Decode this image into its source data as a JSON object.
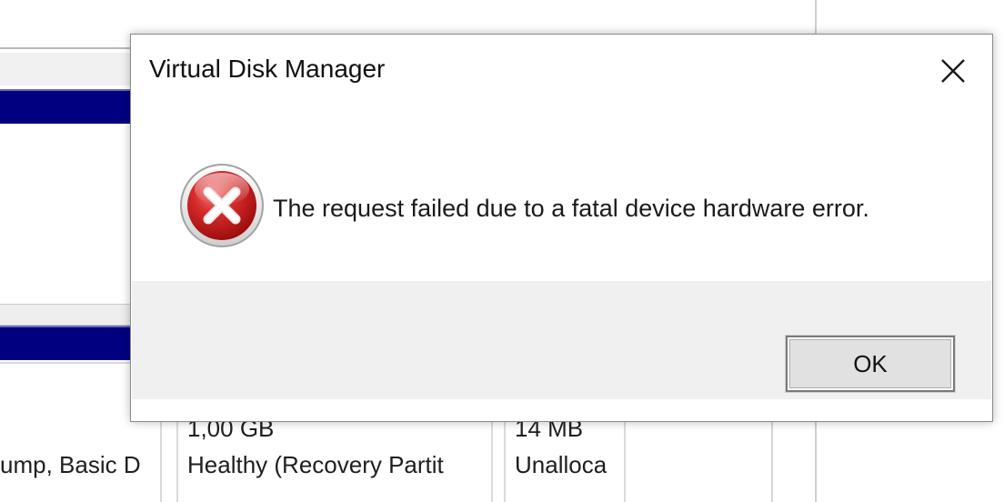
{
  "background_window": {
    "partitions": [
      {
        "size": "",
        "status": "ump, Basic D"
      },
      {
        "size": "1,00 GB",
        "status": "Healthy (Recovery Partit"
      },
      {
        "size": "14 MB",
        "status": "Unalloca"
      }
    ],
    "colors": {
      "disk_bar": "#000080"
    }
  },
  "dialog": {
    "title": "Virtual Disk Manager",
    "close_icon": "close-icon",
    "icon": "error-icon",
    "message": "The request failed due to a fatal device hardware error.",
    "ok_label": "OK",
    "colors": {
      "button_bar": "#f0f0f0",
      "error_red": "#c8171c"
    }
  }
}
